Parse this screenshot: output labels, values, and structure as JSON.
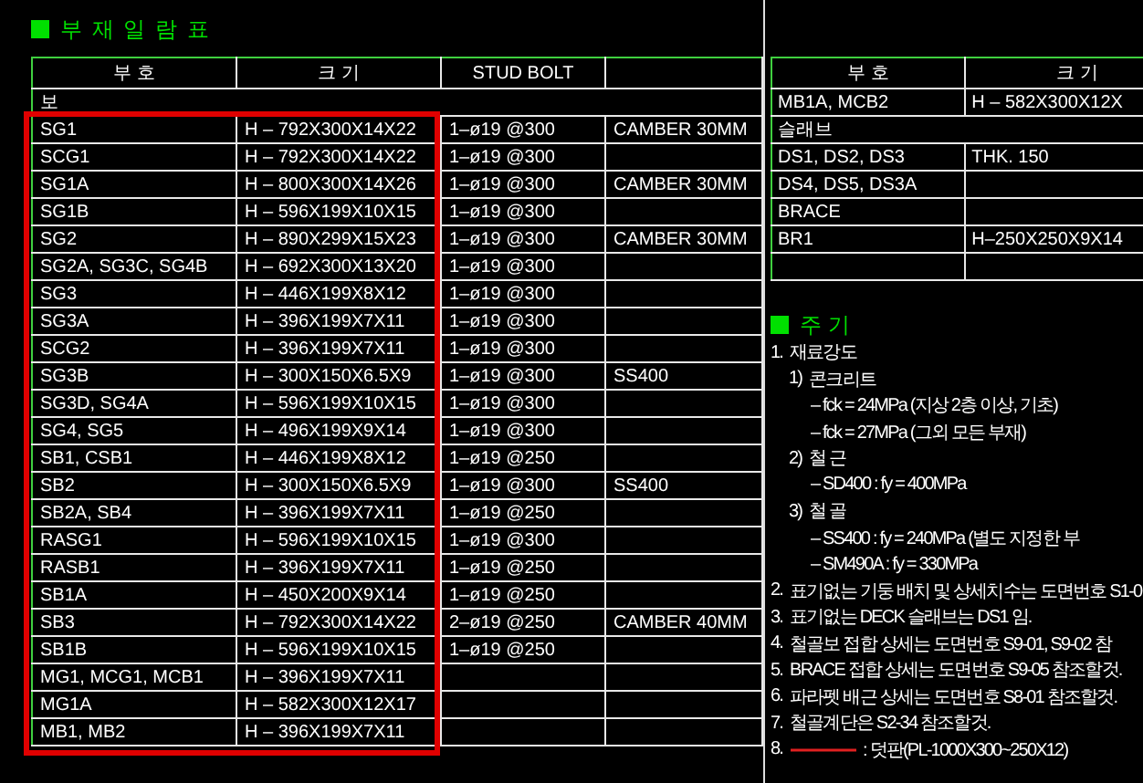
{
  "members_table": {
    "title": "부 재 일 람 표",
    "columns": [
      "부 호",
      "크 기",
      "STUD BOLT"
    ],
    "rows": [
      {
        "kind": "category",
        "label": "보"
      },
      {
        "kind": "member",
        "mark": "SG1",
        "size": "H – 792X300X14X22",
        "stud_bolt": "1–ø19 @300",
        "remark": "CAMBER 30MM"
      },
      {
        "kind": "member",
        "mark": "SCG1",
        "size": "H – 792X300X14X22",
        "stud_bolt": "1–ø19 @300"
      },
      {
        "kind": "member",
        "mark": "SG1A",
        "size": "H – 800X300X14X26",
        "stud_bolt": "1–ø19 @300",
        "remark": "CAMBER 30MM"
      },
      {
        "kind": "member",
        "mark": "SG1B",
        "size": "H – 596X199X10X15",
        "stud_bolt": "1–ø19 @300"
      },
      {
        "kind": "member",
        "mark": "SG2",
        "size": "H – 890X299X15X23",
        "stud_bolt": "1–ø19 @300",
        "remark": "CAMBER 30MM"
      },
      {
        "kind": "member",
        "mark": "SG2A, SG3C, SG4B",
        "size": "H – 692X300X13X20",
        "stud_bolt": "1–ø19 @300"
      },
      {
        "kind": "member",
        "mark": "SG3",
        "size": "H – 446X199X8X12",
        "stud_bolt": "1–ø19 @300"
      },
      {
        "kind": "member",
        "mark": "SG3A",
        "size": "H – 396X199X7X11",
        "stud_bolt": "1–ø19 @300"
      },
      {
        "kind": "member",
        "mark": "SCG2",
        "size": "H – 396X199X7X11",
        "stud_bolt": "1–ø19 @300"
      },
      {
        "kind": "member",
        "mark": "SG3B",
        "size": "H – 300X150X6.5X9",
        "stud_bolt": "1–ø19 @300",
        "remark": "SS400"
      },
      {
        "kind": "member",
        "mark": "SG3D, SG4A",
        "size": "H – 596X199X10X15",
        "stud_bolt": "1–ø19 @300"
      },
      {
        "kind": "member",
        "mark": "SG4,  SG5",
        "size": "H – 496X199X9X14",
        "stud_bolt": "1–ø19 @300"
      },
      {
        "kind": "member",
        "mark": "SB1, CSB1",
        "size": "H – 446X199X8X12",
        "stud_bolt": "1–ø19 @250"
      },
      {
        "kind": "member",
        "mark": "SB2",
        "size": "H – 300X150X6.5X9",
        "stud_bolt": "1–ø19 @300",
        "remark": "SS400"
      },
      {
        "kind": "member",
        "mark": "SB2A, SB4",
        "size": "H – 396X199X7X11",
        "stud_bolt": "1–ø19 @250"
      },
      {
        "kind": "member",
        "mark": "RASG1",
        "size": "H – 596X199X10X15",
        "stud_bolt": "1–ø19 @300"
      },
      {
        "kind": "member",
        "mark": "RASB1",
        "size": "H – 396X199X7X11",
        "stud_bolt": "1–ø19 @250"
      },
      {
        "kind": "member",
        "mark": "SB1A",
        "size": "H – 450X200X9X14",
        "stud_bolt": "1–ø19 @250"
      },
      {
        "kind": "member",
        "mark": "SB3",
        "size": "H – 792X300X14X22",
        "stud_bolt": "2–ø19 @250",
        "remark": "CAMBER 40MM"
      },
      {
        "kind": "member",
        "mark": "SB1B",
        "size": "H – 596X199X10X15",
        "stud_bolt": "1–ø19 @250"
      },
      {
        "kind": "member",
        "mark": "MG1, MCG1, MCB1",
        "size": "H – 396X199X7X11"
      },
      {
        "kind": "member",
        "mark": "MG1A",
        "size": "H – 582X300X12X17"
      },
      {
        "kind": "member",
        "mark": "MB1, MB2",
        "size": "H – 396X199X7X11"
      }
    ]
  },
  "members_table_continued": {
    "columns": [
      "부 호",
      "크 기"
    ],
    "rows": [
      {
        "kind": "member",
        "mark": "MB1A, MCB2",
        "size": "H – 582X300X12X"
      },
      {
        "kind": "category",
        "label": "슬래브"
      },
      {
        "kind": "member",
        "mark": "DS1, DS2, DS3",
        "size": "THK. 150"
      },
      {
        "kind": "member",
        "mark": "DS4, DS5, DS3A"
      },
      {
        "kind": "member",
        "mark": "BRACE"
      },
      {
        "kind": "member",
        "mark": "BR1",
        "size": "H–250X250X9X14"
      },
      {
        "kind": "blank"
      }
    ]
  },
  "notes": {
    "title": "주   기",
    "items": [
      {
        "kind": "text",
        "number": "1.",
        "text": "재료강도",
        "children": [
          {
            "kind": "text",
            "number": "1)",
            "text": "콘크리트",
            "children": [
              {
                "kind": "text",
                "text": "– fck = 24MPa (지상 2층 이상, 기초)"
              },
              {
                "kind": "text",
                "text": "– fck = 27MPa (그외 모든 부재)"
              }
            ]
          },
          {
            "kind": "text",
            "number": "2)",
            "text": "철 근",
            "children": [
              {
                "kind": "text",
                "text": "– SD400 : fy = 400MPa"
              }
            ]
          },
          {
            "kind": "text",
            "number": "3)",
            "text": "철 골",
            "children": [
              {
                "kind": "text",
                "text": "– SS400 : fy = 240MPa (별도 지정한 부"
              },
              {
                "kind": "text",
                "text": "– SM490A : fy = 330MPa"
              }
            ]
          }
        ]
      },
      {
        "kind": "text",
        "number": "2.",
        "text": "표기없는 기둥 배치 및 상세치수는 도면번호 S1-0"
      },
      {
        "kind": "text",
        "number": "3.",
        "text": "표기없는 DECK 슬래브는 DS1 임."
      },
      {
        "kind": "text",
        "number": "4.",
        "text": "철골보 접합 상세는 도면번호 S9-01, S9-02 참"
      },
      {
        "kind": "text",
        "number": "5.",
        "text": "BRACE 접합 상세는 도면번호 S9-05 참조할것."
      },
      {
        "kind": "text",
        "number": "6.",
        "text": "파라펫 배근 상세는 도면번호 S8-01 참조할것."
      },
      {
        "kind": "text",
        "number": "7.",
        "text": "철골계단은 S2-34 참조할것."
      },
      {
        "kind": "legend",
        "number": "8.",
        "text": ": 덧판(PL-1000X300~250X12)"
      }
    ]
  }
}
